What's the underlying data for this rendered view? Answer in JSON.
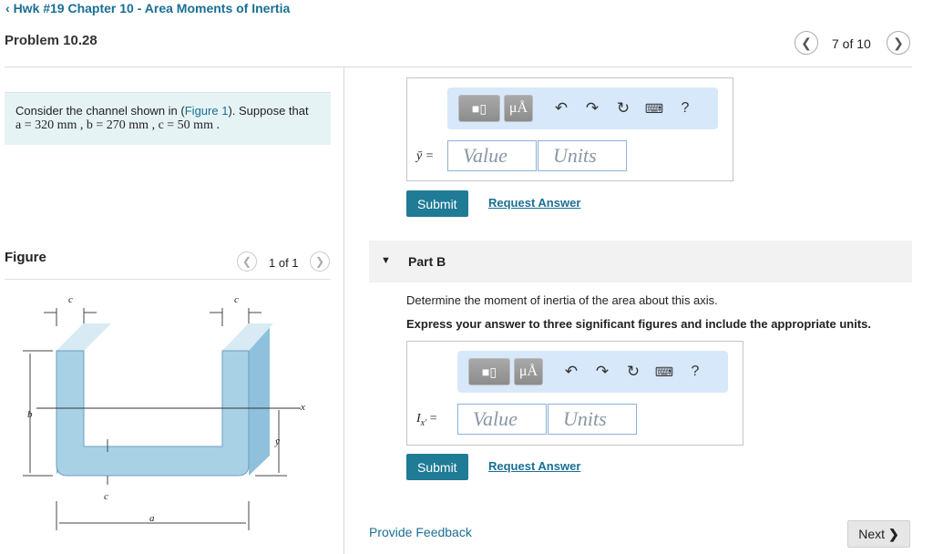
{
  "header": {
    "back_link": "Hwk #19 Chapter 10 - Area Moments of Inertia",
    "problem_title": "Problem 10.28",
    "pager": "7 of 10"
  },
  "prompt": {
    "intro": "Consider the channel shown in (",
    "figure_link": "Figure 1",
    "intro_end": "). Suppose that",
    "values_line": "a = 320  mm , b = 270  mm , c = 50  mm ."
  },
  "figure": {
    "label": "Figure",
    "pager": "1 of 1",
    "labels": {
      "c_left": "c",
      "c_right": "c",
      "b": "b",
      "x": "x",
      "ybar": "ȳ",
      "c_bottom": "c",
      "a": "a"
    }
  },
  "part_a": {
    "var_label": "ȳ =",
    "value_placeholder": "Value",
    "units_placeholder": "Units",
    "submit": "Submit",
    "request_answer": "Request Answer",
    "toolbar": {
      "mu_label": "μÅ",
      "help": "?"
    }
  },
  "part_b": {
    "title": "Part B",
    "question": "Determine the moment of inertia of the area about this axis.",
    "instruction": "Express your answer to three significant figures and include the appropriate units.",
    "var_label": "I",
    "var_sub": "x'",
    "var_eq": " =",
    "value_placeholder": "Value",
    "units_placeholder": "Units",
    "submit": "Submit",
    "request_answer": "Request Answer",
    "toolbar": {
      "mu_label": "μÅ",
      "help": "?"
    }
  },
  "footer": {
    "feedback": "Provide Feedback",
    "next": "Next"
  },
  "colors": {
    "accent": "#1a6f94",
    "submit_bg": "#1f7b96",
    "toolbar_bg": "#d7e8fb",
    "prompt_bg": "#e6f3f5",
    "channel_fill": "#a9d1e6"
  }
}
